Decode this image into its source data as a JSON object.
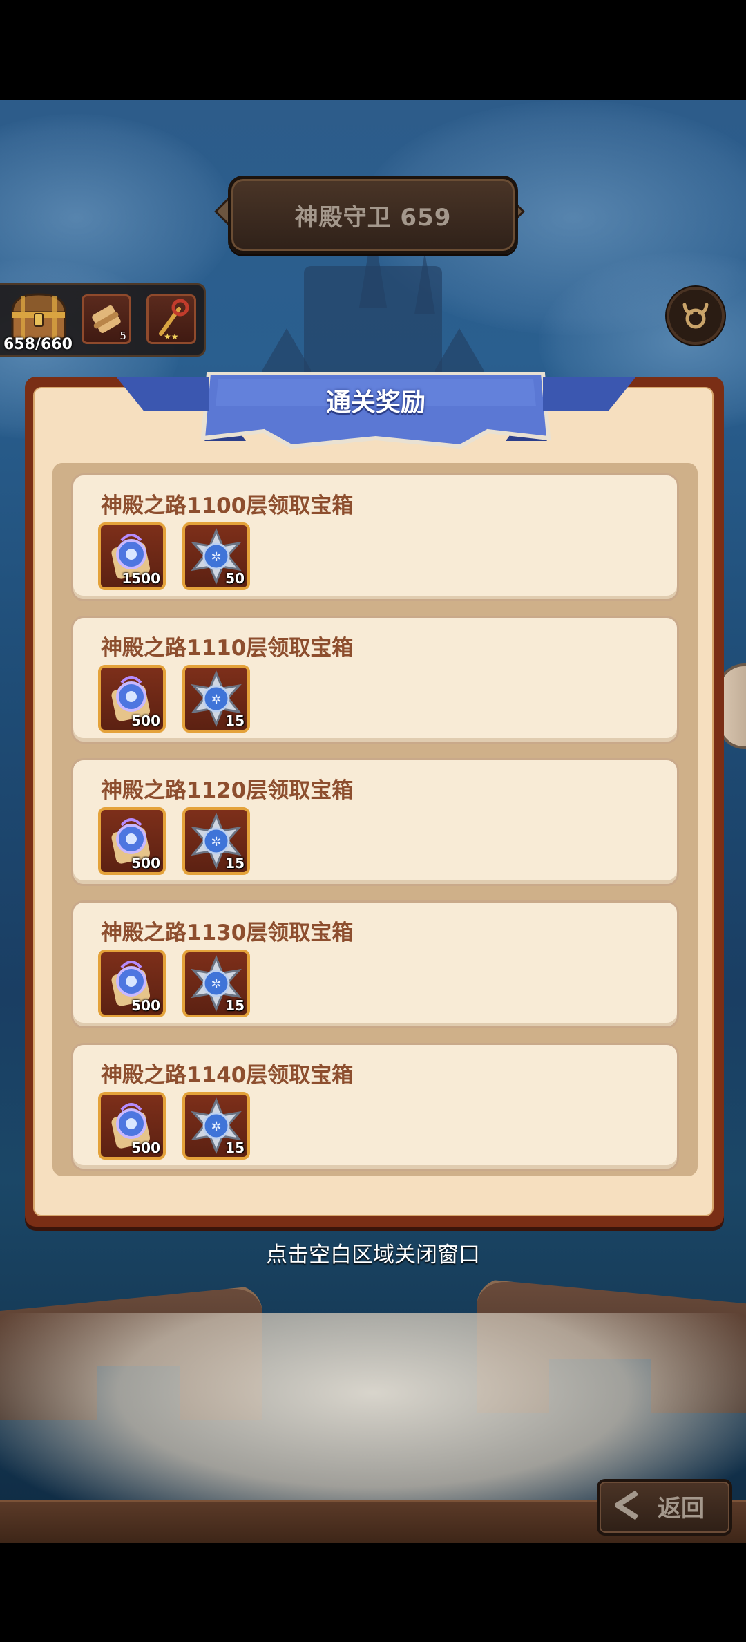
{
  "header": {
    "stage_title": "神殿守卫 659"
  },
  "inventory": {
    "chest_count": "658/660",
    "slot1_count": "5"
  },
  "dialog": {
    "title": "通关奖励",
    "rows": [
      {
        "title": "神殿之路1100层领取宝箱",
        "item1_qty": "1500",
        "item2_qty": "50"
      },
      {
        "title": "神殿之路1110层领取宝箱",
        "item1_qty": "500",
        "item2_qty": "15"
      },
      {
        "title": "神殿之路1120层领取宝箱",
        "item1_qty": "500",
        "item2_qty": "15"
      },
      {
        "title": "神殿之路1130层领取宝箱",
        "item1_qty": "500",
        "item2_qty": "15"
      },
      {
        "title": "神殿之路1140层领取宝箱",
        "item1_qty": "500",
        "item2_qty": "15"
      }
    ]
  },
  "hint": "点击空白区域关闭窗口",
  "back_button": {
    "label": "返回"
  },
  "icons": {
    "item1": "spirit-orb-scroll-icon",
    "item2": "blue-star-emblem-icon",
    "settings": "horned-emblem-icon",
    "chest": "treasure-chest-icon"
  },
  "colors": {
    "dialog_border": "#7a2e15",
    "dialog_bg": "#f6dfbf",
    "ribbon": "#4d6ccf",
    "row_title": "#8d4e2e",
    "item_frame": "#e4a23a"
  }
}
